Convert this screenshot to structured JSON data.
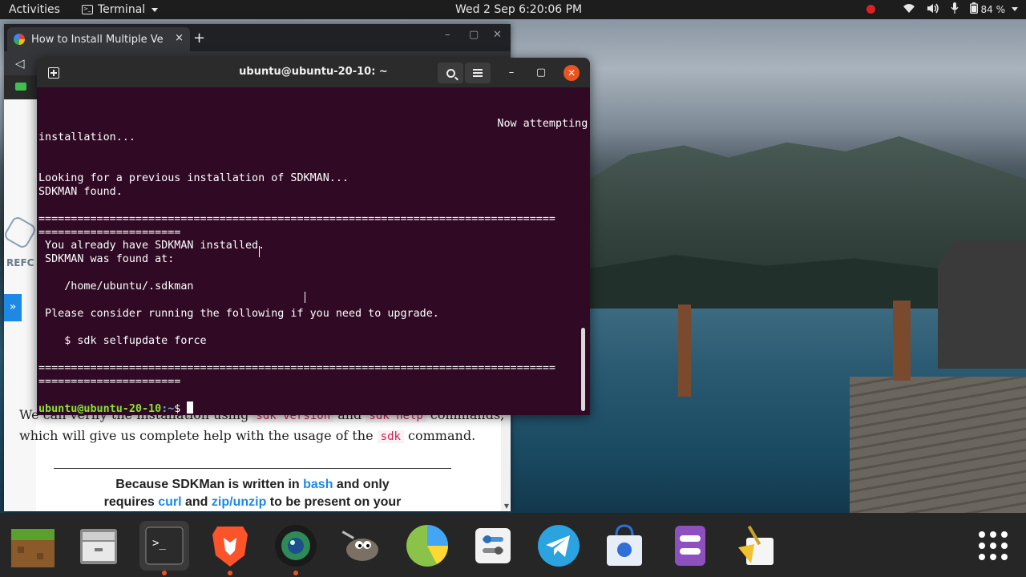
{
  "topbar": {
    "activities": "Activities",
    "app_name": "Terminal",
    "clock": "Wed 2 Sep  6:20:06 PM",
    "battery": "84 %"
  },
  "browser": {
    "tab_title": "How to Install Multiple Ve",
    "tab_close": "×",
    "new_tab": "+",
    "refc_text": "REFC",
    "article_line1_a": "We can verify the installation using ",
    "article_code1": "sdk version",
    "article_line1_b": " and ",
    "article_code2": "sdk help",
    "article_line1_c": " commands,",
    "article_line2_a": "which will give us complete help with the usage of the ",
    "article_code3": "sdk",
    "article_line2_b": " command.",
    "quote_1a": "Because SDKMan is written in ",
    "quote_1b": "bash",
    "quote_1c": " and only",
    "quote_2a": "requires ",
    "quote_2b": "curl",
    "quote_2c": " and ",
    "quote_2d": "zip/unzip",
    "quote_2e": " to be present on your"
  },
  "terminal": {
    "title": "ubuntu@ubuntu-20-10: ~",
    "lines": {
      "l1": "                                                                       Now attempting",
      "l2": "installation...",
      "l3": "Looking for a previous installation of SDKMAN...",
      "l4": "SDKMAN found.",
      "sep1a": "================================================================================",
      "sep1b": "======================",
      "l5": " You already have SDKMAN installed.",
      "l6": " SDKMAN was found at:",
      "l7": "    /home/ubuntu/.sdkman",
      "l8": " Please consider running the following if you need to upgrade.",
      "l9": "    $ sdk selfupdate force",
      "sep2a": "================================================================================",
      "sep2b": "======================"
    },
    "prompt_user": "ubuntu@ubuntu-20-10",
    "prompt_path": ":~",
    "prompt_symbol": "$ "
  },
  "dock": {
    "items": [
      "minecraft-icon",
      "files-icon",
      "terminal-icon",
      "brave-icon",
      "camera-icon",
      "gimp-icon",
      "charts-icon",
      "settings-icon",
      "telegram-icon",
      "software-store-icon",
      "tweaks-icon",
      "bleachbit-icon",
      "show-apps-icon"
    ]
  }
}
